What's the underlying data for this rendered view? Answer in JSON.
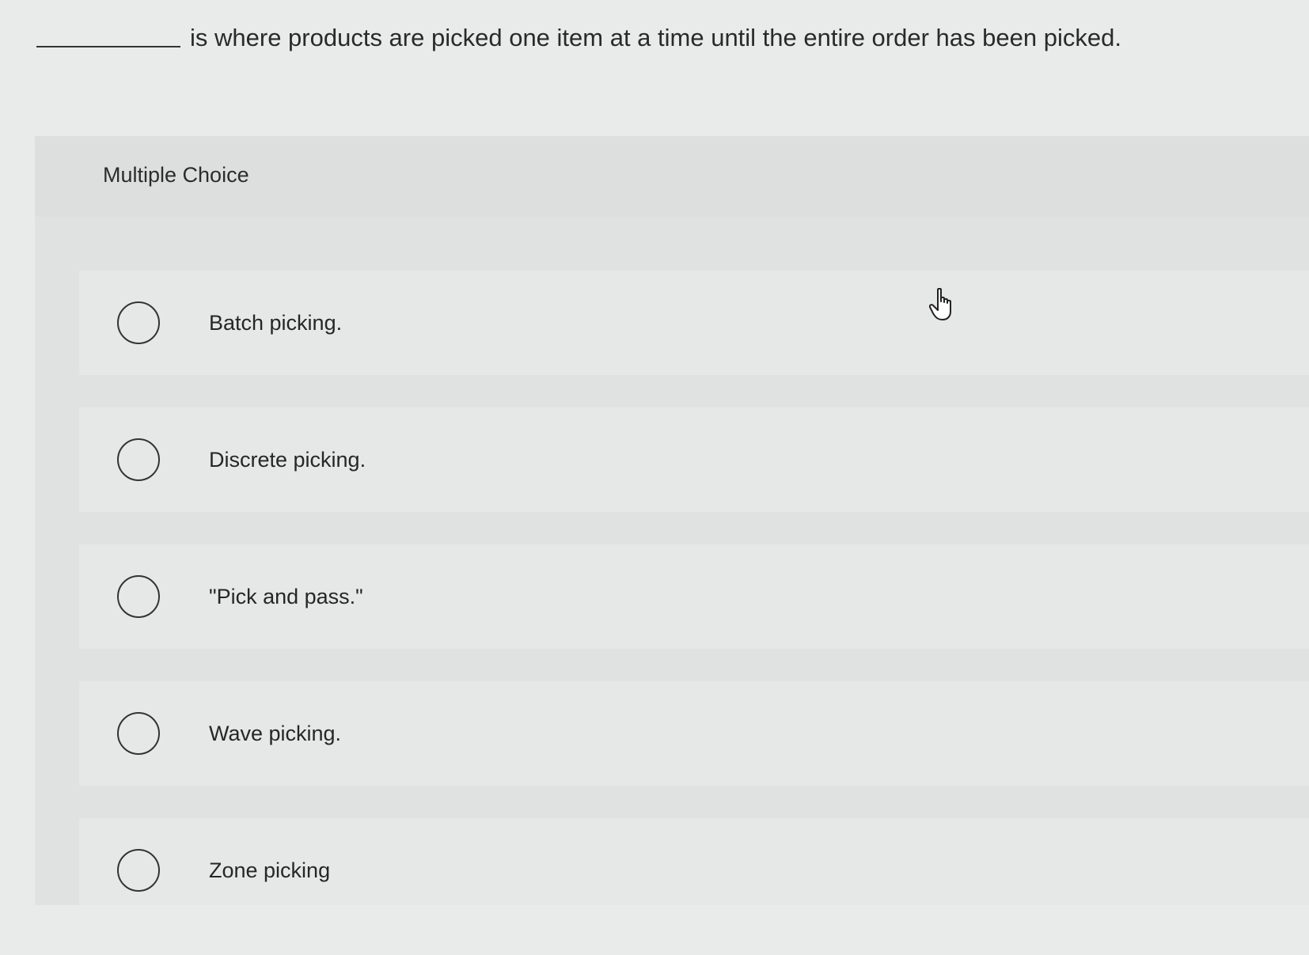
{
  "question": {
    "blank": "__________",
    "text": "is where products are picked one item at a time until the entire order has been picked."
  },
  "section": {
    "title": "Multiple Choice"
  },
  "options": [
    {
      "label": "Batch picking.",
      "selected": false
    },
    {
      "label": "Discrete picking.",
      "selected": false
    },
    {
      "label": "\"Pick and pass.\"",
      "selected": false
    },
    {
      "label": "Wave picking.",
      "selected": false
    },
    {
      "label": "Zone picking",
      "selected": false
    }
  ],
  "icons": {
    "cursor": "hand-pointer-icon",
    "radio": "radio-unchecked-icon"
  },
  "colors": {
    "background": "#e9ebea",
    "panel": "#dfe2e1",
    "text": "#2b2b2b"
  }
}
